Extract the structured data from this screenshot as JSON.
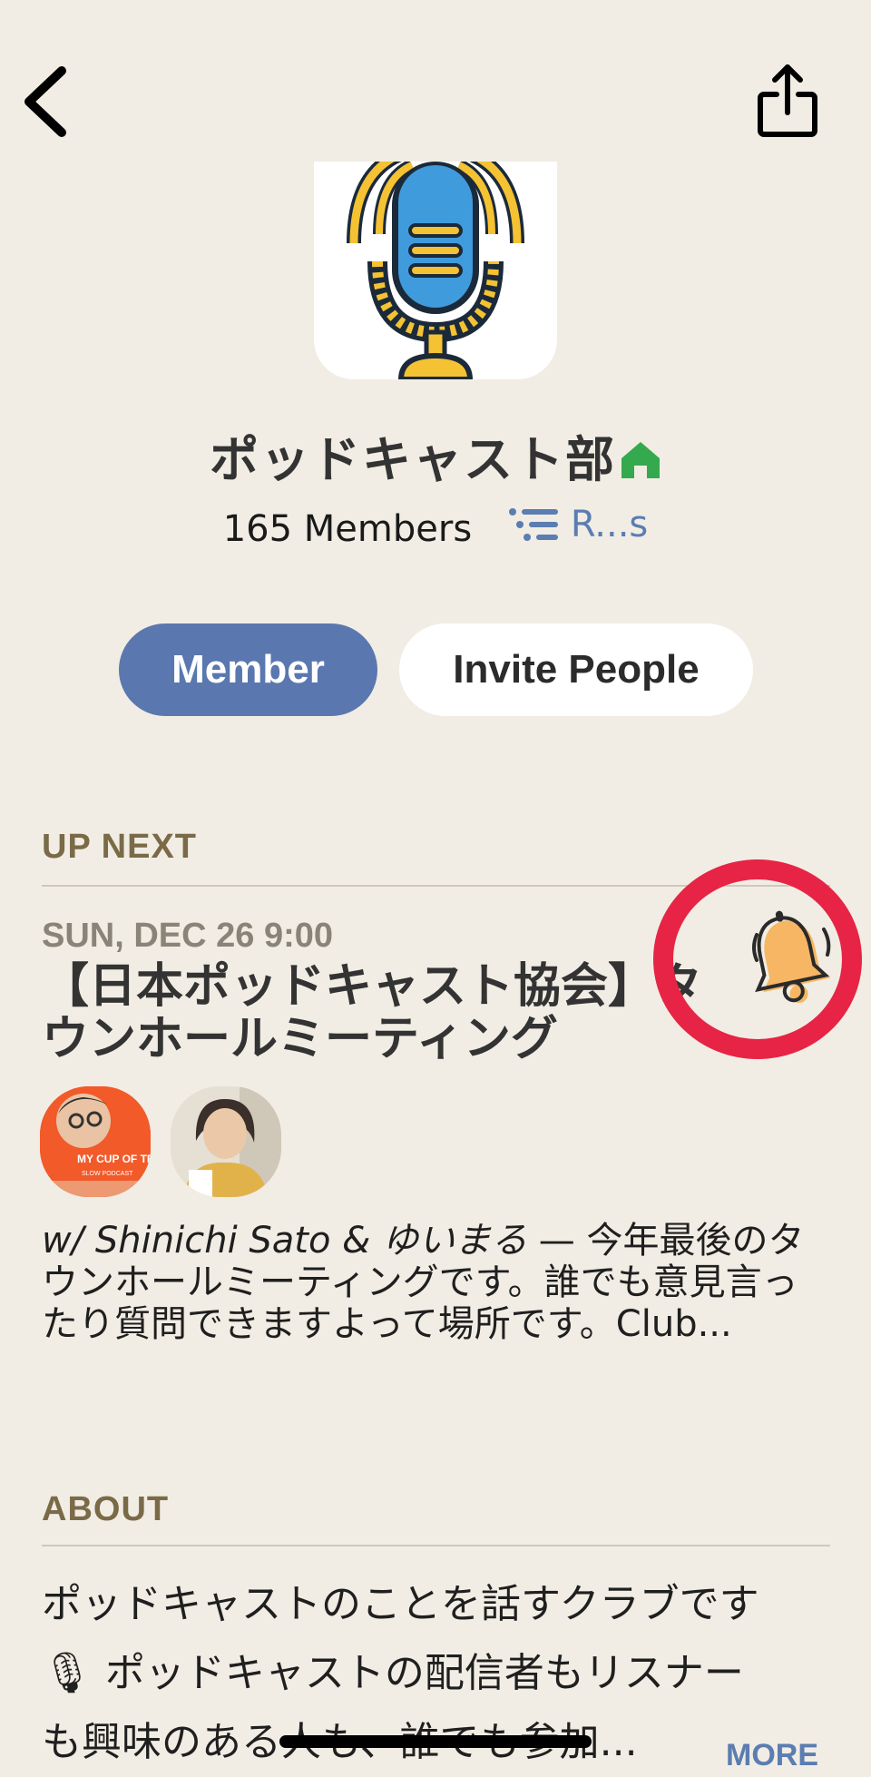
{
  "header": {
    "back_icon": "chevron-left-icon",
    "share_icon": "share-icon"
  },
  "club": {
    "avatar_icon": "microphone-icon",
    "name": "ポッドキャスト部",
    "house_icon": "house-icon",
    "house_color": "#35A94E",
    "members_count": "165 Members",
    "rules_icon": "list-icon",
    "rules_label": "R...s"
  },
  "actions": {
    "member_label": "Member",
    "invite_label": "Invite People"
  },
  "up_next": {
    "section_title": "UP NEXT",
    "event": {
      "date": "SUN, DEC 26 9:00",
      "title": "【日本ポッドキャスト協会】タウンホールミーティング",
      "bell_icon": "bell-icon",
      "highlight_color": "#E72445",
      "hosts_prefix": "w/ Shinichi Sato & ゆいまる",
      "description": " — 今年最後のタウンホールミーティングです。誰でも意見言ったり質問できますよって場所です。Club...",
      "avatar1_caption": "MY CUP OF TEA",
      "avatar1_subcaption": "SLOW PODCAST"
    }
  },
  "about": {
    "section_title": "ABOUT",
    "line1": "ポッドキャストのことを話すクラブです",
    "line2": "🎙 ポッドキャストの配信者もリスナー",
    "line3": "も興味のある人も、誰でも参加...",
    "more_label": "MORE"
  },
  "colors": {
    "background": "#F1EDE4",
    "accent_blue": "#5A78AF",
    "section_brown": "#7A6A47"
  }
}
